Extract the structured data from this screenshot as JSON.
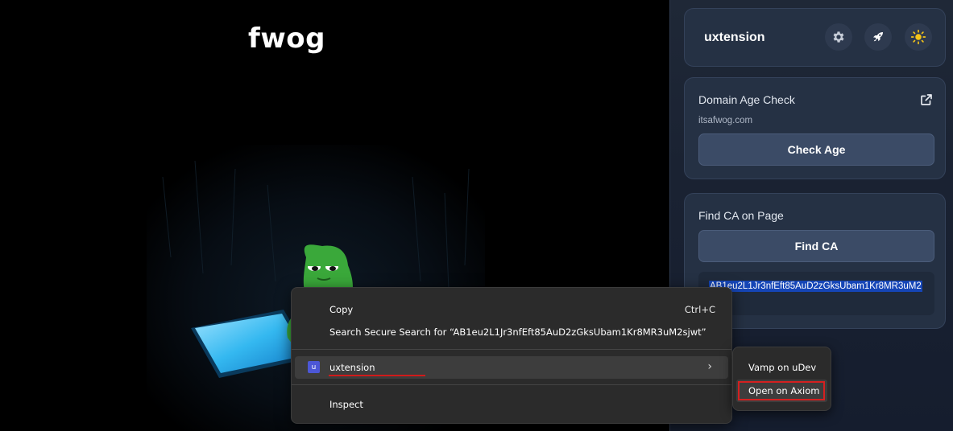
{
  "page": {
    "title": "fwog"
  },
  "extension": {
    "title": "uxtension",
    "header_icons": [
      "gear-icon",
      "rocket-icon",
      "sun-icon"
    ],
    "domain_card": {
      "title": "Domain Age Check",
      "domain": "itsafwog.com",
      "button": "Check Age",
      "link_icon": "external-link-icon"
    },
    "find_ca_card": {
      "title": "Find CA on Page",
      "button": "Find CA",
      "result": "AB1eu2L1Jr3nfEft85AuD2zGksUbam1Kr8MR3uM2"
    }
  },
  "context_menu": {
    "items": [
      {
        "label": "Copy",
        "shortcut": "Ctrl+C"
      },
      {
        "label": "Search Secure Search for “AB1eu2L1Jr3nfEft85AuD2zGksUbam1Kr8MR3uM2sjwt”"
      },
      {
        "label": "uxtension",
        "icon": "u",
        "has_submenu": true
      },
      {
        "label": "Inspect"
      }
    ],
    "submenu": [
      {
        "label": "Vamp on uDev"
      },
      {
        "label": "Open on Axiom"
      }
    ]
  },
  "colors": {
    "accent_blue": "#1545b6",
    "highlight_red": "#d42020",
    "panel_bg": "#1f2837",
    "card_bg": "#253144",
    "button_bg": "#3b4b66",
    "extension_icon": "#4c57d6"
  }
}
